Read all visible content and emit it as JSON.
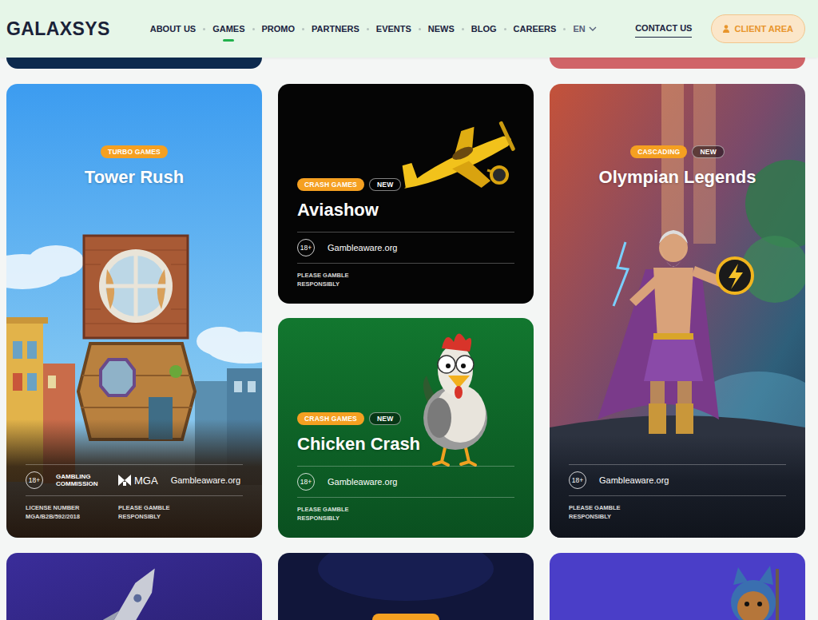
{
  "header": {
    "logo": "GALAXSYS",
    "nav": [
      {
        "label": "ABOUT US",
        "selected": false
      },
      {
        "label": "GAMES",
        "selected": true
      },
      {
        "label": "PROMO",
        "selected": false
      },
      {
        "label": "PARTNERS",
        "selected": false
      },
      {
        "label": "EVENTS",
        "selected": false
      },
      {
        "label": "NEWS",
        "selected": false
      },
      {
        "label": "BLOG",
        "selected": false
      },
      {
        "label": "CAREERS",
        "selected": false
      }
    ],
    "language": "EN",
    "contact": "CONTACT US",
    "client_area": "CLIENT AREA"
  },
  "cards": [
    {
      "kind": "tall",
      "tags": [
        {
          "label": "TURBO GAMES",
          "kind": "category"
        }
      ],
      "title": "Tower Rush",
      "age": "18+",
      "regulators": [
        {
          "label": "GAMBLING COMMISSION",
          "kind": "text"
        },
        {
          "label": "MGA",
          "kind": "logo"
        }
      ],
      "gambleaware": "Gambleaware.org",
      "license_label": "LICENSE NUMBER",
      "license_number": "MGA/B2B/592/2018",
      "responsible": "PLEASE GAMBLE RESPONSIBLY"
    },
    {
      "kind": "short",
      "tags": [
        {
          "label": "CRASH GAMES",
          "kind": "category"
        },
        {
          "label": "NEW",
          "kind": "new"
        }
      ],
      "title": "Aviashow",
      "age": "18+",
      "gambleaware": "Gambleaware.org",
      "responsible": "PLEASE GAMBLE RESPONSIBLY"
    },
    {
      "kind": "short",
      "tags": [
        {
          "label": "CRASH GAMES",
          "kind": "category"
        },
        {
          "label": "NEW",
          "kind": "new"
        }
      ],
      "title": "Chicken Crash",
      "age": "18+",
      "gambleaware": "Gambleaware.org",
      "responsible": "PLEASE GAMBLE RESPONSIBLY"
    },
    {
      "kind": "tall",
      "tags": [
        {
          "label": "CASCADING",
          "kind": "category"
        },
        {
          "label": "NEW",
          "kind": "new"
        }
      ],
      "title": "Olympian Legends",
      "age": "18+",
      "gambleaware": "Gambleaware.org",
      "responsible": "PLEASE GAMBLE RESPONSIBLY"
    }
  ]
}
